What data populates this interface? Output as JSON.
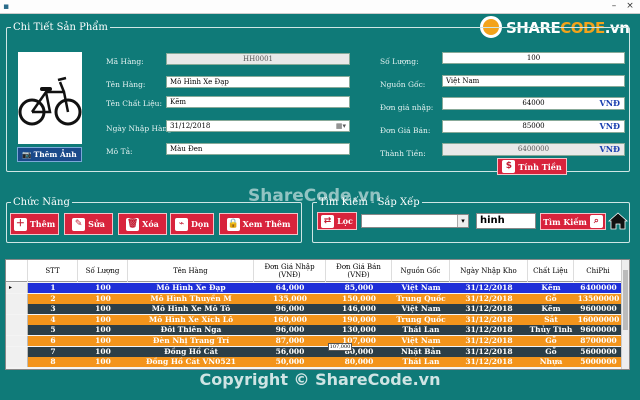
{
  "window": {
    "minimize": "–",
    "close": "×",
    "app_icon": "app-icon"
  },
  "brand": {
    "share": "SHARE",
    "code": "CODE",
    "domain": ".vn"
  },
  "detail": {
    "legend": "Chi Tiết Sản Phẩm",
    "photo_button": "Thêm Ảnh",
    "ma_hang": {
      "label": "Mã Hàng:",
      "value": "HH0001"
    },
    "ten_hang": {
      "label": "Tên Hàng:",
      "value": "Mô Hình Xe Đạp"
    },
    "chat_lieu": {
      "label": "Tên Chất Liệu:",
      "value": "Kẽm"
    },
    "ngay_nhap": {
      "label": "Ngày Nhập Hàng:",
      "value": "31/12/2018"
    },
    "mo_ta": {
      "label": "Mô Tả:",
      "value": "Màu Đen"
    },
    "so_luong": {
      "label": "Số Lượng:",
      "value": "100"
    },
    "nguon_goc": {
      "label": "Nguồn Gốc:",
      "value": "Việt Nam"
    },
    "don_gia_nhap": {
      "label": "Đơn giá nhập:",
      "value": "64000",
      "unit": "VNĐ"
    },
    "don_gia_ban": {
      "label": "Đơn Giá Bán:",
      "value": "85000",
      "unit": "VNĐ"
    },
    "thanh_tien": {
      "label": "Thành Tiền:",
      "value": "6400000",
      "unit": "VNĐ"
    },
    "tinh_tien_button": "Tính Tiền"
  },
  "functions": {
    "legend": "Chức Năng",
    "them": "Thêm",
    "sua": "Sửa",
    "xoa": "Xóa",
    "don": "Dọn",
    "xem_them": "Xem Thêm"
  },
  "search": {
    "legend": "Tìm Kiếm - Sắp Xếp",
    "loc_button": "Lọc",
    "query": "hinh",
    "search_button": "Tìm Kiếm"
  },
  "watermark": "ShareCode.vn",
  "copyright": "Copyright © ShareCode.vn",
  "tooltip": "107,000",
  "table": {
    "columns": [
      "STT",
      "Số Lượng",
      "Tên Hàng",
      "Đơn Giá Nhập (VNĐ)",
      "Đơn Giá Bán (VNĐ)",
      "Nguồn Gốc",
      "Ngày Nhập Kho",
      "Chất Liệu",
      "ChiPhi"
    ],
    "rows": [
      [
        "1",
        "100",
        "Mô Hình Xe Đạp",
        "64,000",
        "85,000",
        "Việt Nam",
        "31/12/2018",
        "Kẽm",
        "6400000"
      ],
      [
        "2",
        "100",
        "Mô Hình Thuyền M",
        "135,000",
        "150,000",
        "Trung Quốc",
        "31/12/2018",
        "Gỗ",
        "13500000"
      ],
      [
        "3",
        "100",
        "Mô Hình Xe Mô Tô",
        "96,000",
        "146,000",
        "Việt Nam",
        "31/12/2018",
        "Kẽm",
        "9600000"
      ],
      [
        "4",
        "100",
        "Mô Hình Xe Xích Lô",
        "160,000",
        "190,000",
        "Trung Quốc",
        "31/12/2018",
        "Sắt",
        "16000000"
      ],
      [
        "5",
        "100",
        "Đôi  Thiên Nga",
        "96,000",
        "130,000",
        "Thái Lan",
        "31/12/2018",
        "Thủy Tinh",
        "9600000"
      ],
      [
        "6",
        "100",
        "Đèn Nhị Trang Trí",
        "87,000",
        "107,000",
        "Việt Nam",
        "31/12/2018",
        "Gỗ",
        "8700000"
      ],
      [
        "7",
        "100",
        "Đồng Hồ Cát",
        "56,000",
        "80,000",
        "Nhật Bản",
        "31/12/2018",
        "Gỗ",
        "5600000"
      ],
      [
        "8",
        "100",
        "Đồng Hồ Cát VN0521",
        "50,000",
        "80,000",
        "Thái Lan",
        "31/12/2018",
        "Nhựa",
        "5000000"
      ]
    ],
    "row_colors": [
      "#1f2fd8",
      "#f3941b",
      "#2c3e47",
      "#f3941b",
      "#2c3e47",
      "#f3941b",
      "#2c3e47",
      "#f3941b"
    ],
    "row_text_colors": [
      "#ffffff",
      "#ffffff",
      "#ffffff",
      "#ffffff",
      "#ffffff",
      "#ffffff",
      "#ffffff",
      "#ffffff"
    ]
  }
}
